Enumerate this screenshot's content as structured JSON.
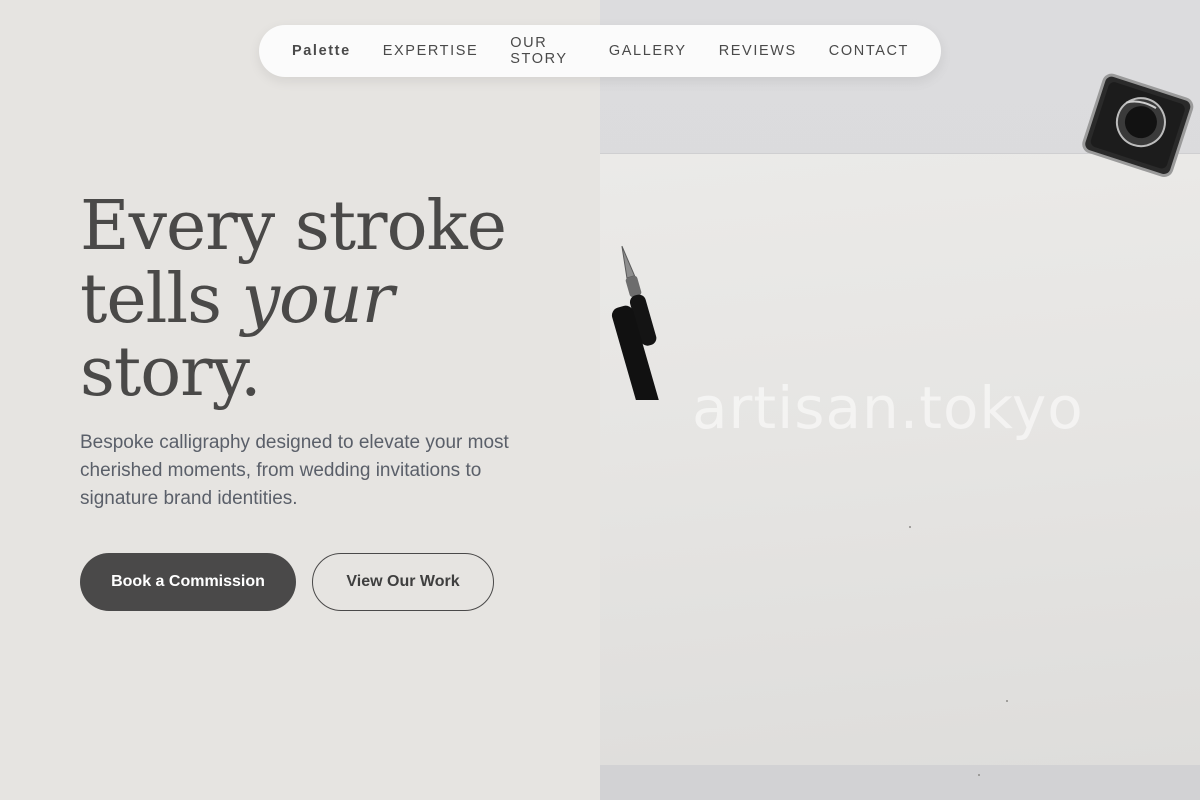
{
  "brand": {
    "logo": "Palette"
  },
  "nav": {
    "items": [
      {
        "label": "EXPERTISE"
      },
      {
        "label": "OUR STORY"
      },
      {
        "label": "GALLERY"
      },
      {
        "label": "REVIEWS"
      },
      {
        "label": "CONTACT"
      }
    ]
  },
  "hero": {
    "headline_line1": "Every stroke",
    "headline_line2_plain": "tells ",
    "headline_line2_italic": "your",
    "headline_line3": "story.",
    "subheading": "Bespoke calligraphy designed to elevate your most cherished moments, from wedding invitations to signature brand identities.",
    "primary_button": "Book a Commission",
    "secondary_button": "View Our Work"
  },
  "image": {
    "watermark": "artisan.tokyo",
    "icons": [
      "ink-bottle-icon",
      "dip-pen-icon"
    ]
  },
  "colors": {
    "left_background": "#e6e4e1",
    "text_dark": "#4a4948",
    "text_sub": "#5a5f69",
    "button_dark": "#4a4949",
    "nav_background": "#fbfbfb"
  }
}
